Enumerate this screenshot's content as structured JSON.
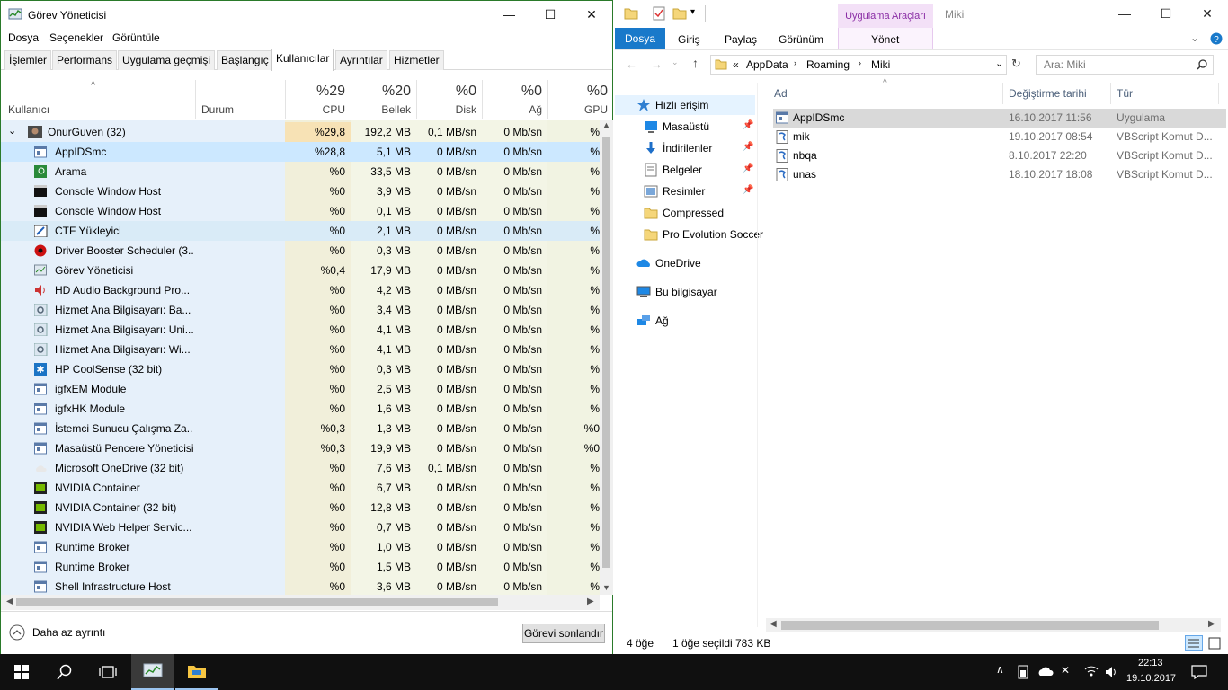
{
  "task_manager": {
    "title": "Görev Yöneticisi",
    "window_buttons": {
      "minimize": "—",
      "maximize": "☐",
      "close": "✕"
    },
    "menu": [
      "Dosya",
      "Seçenekler",
      "Görüntüle"
    ],
    "tabs": [
      "İşlemler",
      "Performans",
      "Uygulama geçmişi",
      "Başlangıç",
      "Kullanıcılar",
      "Ayrıntılar",
      "Hizmetler"
    ],
    "active_tab": "Kullanıcılar",
    "header": {
      "sort_arrow": "^",
      "user_col": "Kullanıcı",
      "status_col": "Durum",
      "cpu_pct": "%29",
      "cpu_lbl": "CPU",
      "mem_pct": "%20",
      "mem_lbl": "Bellek",
      "disk_pct": "%0",
      "disk_lbl": "Disk",
      "net_pct": "%0",
      "net_lbl": "Ağ",
      "gpu_pct": "%0",
      "gpu_lbl": "GPU"
    },
    "group": {
      "name": "OnurGuven (32)",
      "cpu": "%29,8",
      "mem": "192,2 MB",
      "disk": "0,1 MB/sn",
      "net": "0 Mb/sn",
      "gpu": "%"
    },
    "processes": [
      {
        "name": "AppIDSmc",
        "cpu": "%28,8",
        "mem": "5,1 MB",
        "disk": "0 MB/sn",
        "net": "0 Mb/sn",
        "gpu": "%"
      },
      {
        "name": "Arama",
        "cpu": "%0",
        "mem": "33,5 MB",
        "disk": "0 MB/sn",
        "net": "0 Mb/sn",
        "gpu": "%"
      },
      {
        "name": "Console Window Host",
        "cpu": "%0",
        "mem": "3,9 MB",
        "disk": "0 MB/sn",
        "net": "0 Mb/sn",
        "gpu": "%"
      },
      {
        "name": "Console Window Host",
        "cpu": "%0",
        "mem": "0,1 MB",
        "disk": "0 MB/sn",
        "net": "0 Mb/sn",
        "gpu": "%"
      },
      {
        "name": "CTF Yükleyici",
        "cpu": "%0",
        "mem": "2,1 MB",
        "disk": "0 MB/sn",
        "net": "0 Mb/sn",
        "gpu": "%"
      },
      {
        "name": "Driver Booster Scheduler (3...",
        "cpu": "%0",
        "mem": "0,3 MB",
        "disk": "0 MB/sn",
        "net": "0 Mb/sn",
        "gpu": "%"
      },
      {
        "name": "Görev Yöneticisi",
        "cpu": "%0,4",
        "mem": "17,9 MB",
        "disk": "0 MB/sn",
        "net": "0 Mb/sn",
        "gpu": "%"
      },
      {
        "name": "HD Audio Background Pro...",
        "cpu": "%0",
        "mem": "4,2 MB",
        "disk": "0 MB/sn",
        "net": "0 Mb/sn",
        "gpu": "%"
      },
      {
        "name": "Hizmet Ana Bilgisayarı: Ba...",
        "cpu": "%0",
        "mem": "3,4 MB",
        "disk": "0 MB/sn",
        "net": "0 Mb/sn",
        "gpu": "%"
      },
      {
        "name": "Hizmet Ana Bilgisayarı: Uni...",
        "cpu": "%0",
        "mem": "4,1 MB",
        "disk": "0 MB/sn",
        "net": "0 Mb/sn",
        "gpu": "%"
      },
      {
        "name": "Hizmet Ana Bilgisayarı: Wi...",
        "cpu": "%0",
        "mem": "4,1 MB",
        "disk": "0 MB/sn",
        "net": "0 Mb/sn",
        "gpu": "%"
      },
      {
        "name": "HP CoolSense (32 bit)",
        "cpu": "%0",
        "mem": "0,3 MB",
        "disk": "0 MB/sn",
        "net": "0 Mb/sn",
        "gpu": "%"
      },
      {
        "name": "igfxEM Module",
        "cpu": "%0",
        "mem": "2,5 MB",
        "disk": "0 MB/sn",
        "net": "0 Mb/sn",
        "gpu": "%"
      },
      {
        "name": "igfxHK Module",
        "cpu": "%0",
        "mem": "1,6 MB",
        "disk": "0 MB/sn",
        "net": "0 Mb/sn",
        "gpu": "%"
      },
      {
        "name": "İstemci Sunucu Çalışma Za...",
        "cpu": "%0,3",
        "mem": "1,3 MB",
        "disk": "0 MB/sn",
        "net": "0 Mb/sn",
        "gpu": "%0"
      },
      {
        "name": "Masaüstü Pencere Yöneticisi",
        "cpu": "%0,3",
        "mem": "19,9 MB",
        "disk": "0 MB/sn",
        "net": "0 Mb/sn",
        "gpu": "%0"
      },
      {
        "name": "Microsoft OneDrive (32 bit)",
        "cpu": "%0",
        "mem": "7,6 MB",
        "disk": "0,1 MB/sn",
        "net": "0 Mb/sn",
        "gpu": "%"
      },
      {
        "name": "NVIDIA Container",
        "cpu": "%0",
        "mem": "6,7 MB",
        "disk": "0 MB/sn",
        "net": "0 Mb/sn",
        "gpu": "%"
      },
      {
        "name": "NVIDIA Container (32 bit)",
        "cpu": "%0",
        "mem": "12,8 MB",
        "disk": "0 MB/sn",
        "net": "0 Mb/sn",
        "gpu": "%"
      },
      {
        "name": "NVIDIA Web Helper Servic...",
        "cpu": "%0",
        "mem": "0,7 MB",
        "disk": "0 MB/sn",
        "net": "0 Mb/sn",
        "gpu": "%"
      },
      {
        "name": "Runtime Broker",
        "cpu": "%0",
        "mem": "1,0 MB",
        "disk": "0 MB/sn",
        "net": "0 Mb/sn",
        "gpu": "%"
      },
      {
        "name": "Runtime Broker",
        "cpu": "%0",
        "mem": "1,5 MB",
        "disk": "0 MB/sn",
        "net": "0 Mb/sn",
        "gpu": "%"
      },
      {
        "name": "Shell Infrastructure Host",
        "cpu": "%0",
        "mem": "3,6 MB",
        "disk": "0 MB/sn",
        "net": "0 Mb/sn",
        "gpu": "%"
      }
    ],
    "fewer_details": "Daha az ayrıntı",
    "end_task": "Görevi sonlandır"
  },
  "explorer": {
    "title": "Miki",
    "ribbon_tabs": {
      "file": "Dosya",
      "home": "Giriş",
      "share": "Paylaş",
      "view": "Görünüm"
    },
    "tools_tab": "Uygulama Araçları",
    "tools_sub": "Yönet",
    "breadcrumb": {
      "prefix": "«",
      "parts": [
        "AppData",
        "Roaming",
        "Miki"
      ]
    },
    "search_placeholder": "Ara: Miki",
    "columns": {
      "name": "Ad",
      "date": "Değiştirme tarihi",
      "type": "Tür"
    },
    "nav": [
      {
        "label": "Hızlı erişim",
        "icon": "star-icon",
        "pinned": false
      },
      {
        "label": "Masaüstü",
        "icon": "desktop-icon",
        "pinned": true
      },
      {
        "label": "İndirilenler",
        "icon": "download-icon",
        "pinned": true
      },
      {
        "label": "Belgeler",
        "icon": "document-icon",
        "pinned": true
      },
      {
        "label": "Resimler",
        "icon": "pictures-icon",
        "pinned": true
      },
      {
        "label": "Compressed",
        "icon": "folder-icon",
        "pinned": false
      },
      {
        "label": "Pro Evolution Soccer",
        "icon": "folder-icon",
        "pinned": false
      },
      {
        "label": "OneDrive",
        "icon": "cloud-icon",
        "pinned": false
      },
      {
        "label": "Bu bilgisayar",
        "icon": "computer-icon",
        "pinned": false
      },
      {
        "label": "Ağ",
        "icon": "network-icon",
        "pinned": false
      }
    ],
    "files": [
      {
        "name": "AppIDSmc",
        "date": "16.10.2017 11:56",
        "type": "Uygulama",
        "selected": true
      },
      {
        "name": "mik",
        "date": "19.10.2017 08:54",
        "type": "VBScript Komut D..."
      },
      {
        "name": "nbqa",
        "date": "8.10.2017 22:20",
        "type": "VBScript Komut D..."
      },
      {
        "name": "unas",
        "date": "18.10.2017 18:08",
        "type": "VBScript Komut D..."
      }
    ],
    "status": {
      "count": "4 öğe",
      "selected": "1 öğe seçildi",
      "size": "783 KB"
    }
  },
  "taskbar": {
    "time": "22:13",
    "date": "19.10.2017"
  },
  "colors": {
    "selection": "#cce8ff",
    "row_bg": "#e6f0fa",
    "heat_high": "#f7e2b5",
    "ribbon_blue": "#1979ca",
    "tools_purple": "#8a2da5"
  }
}
